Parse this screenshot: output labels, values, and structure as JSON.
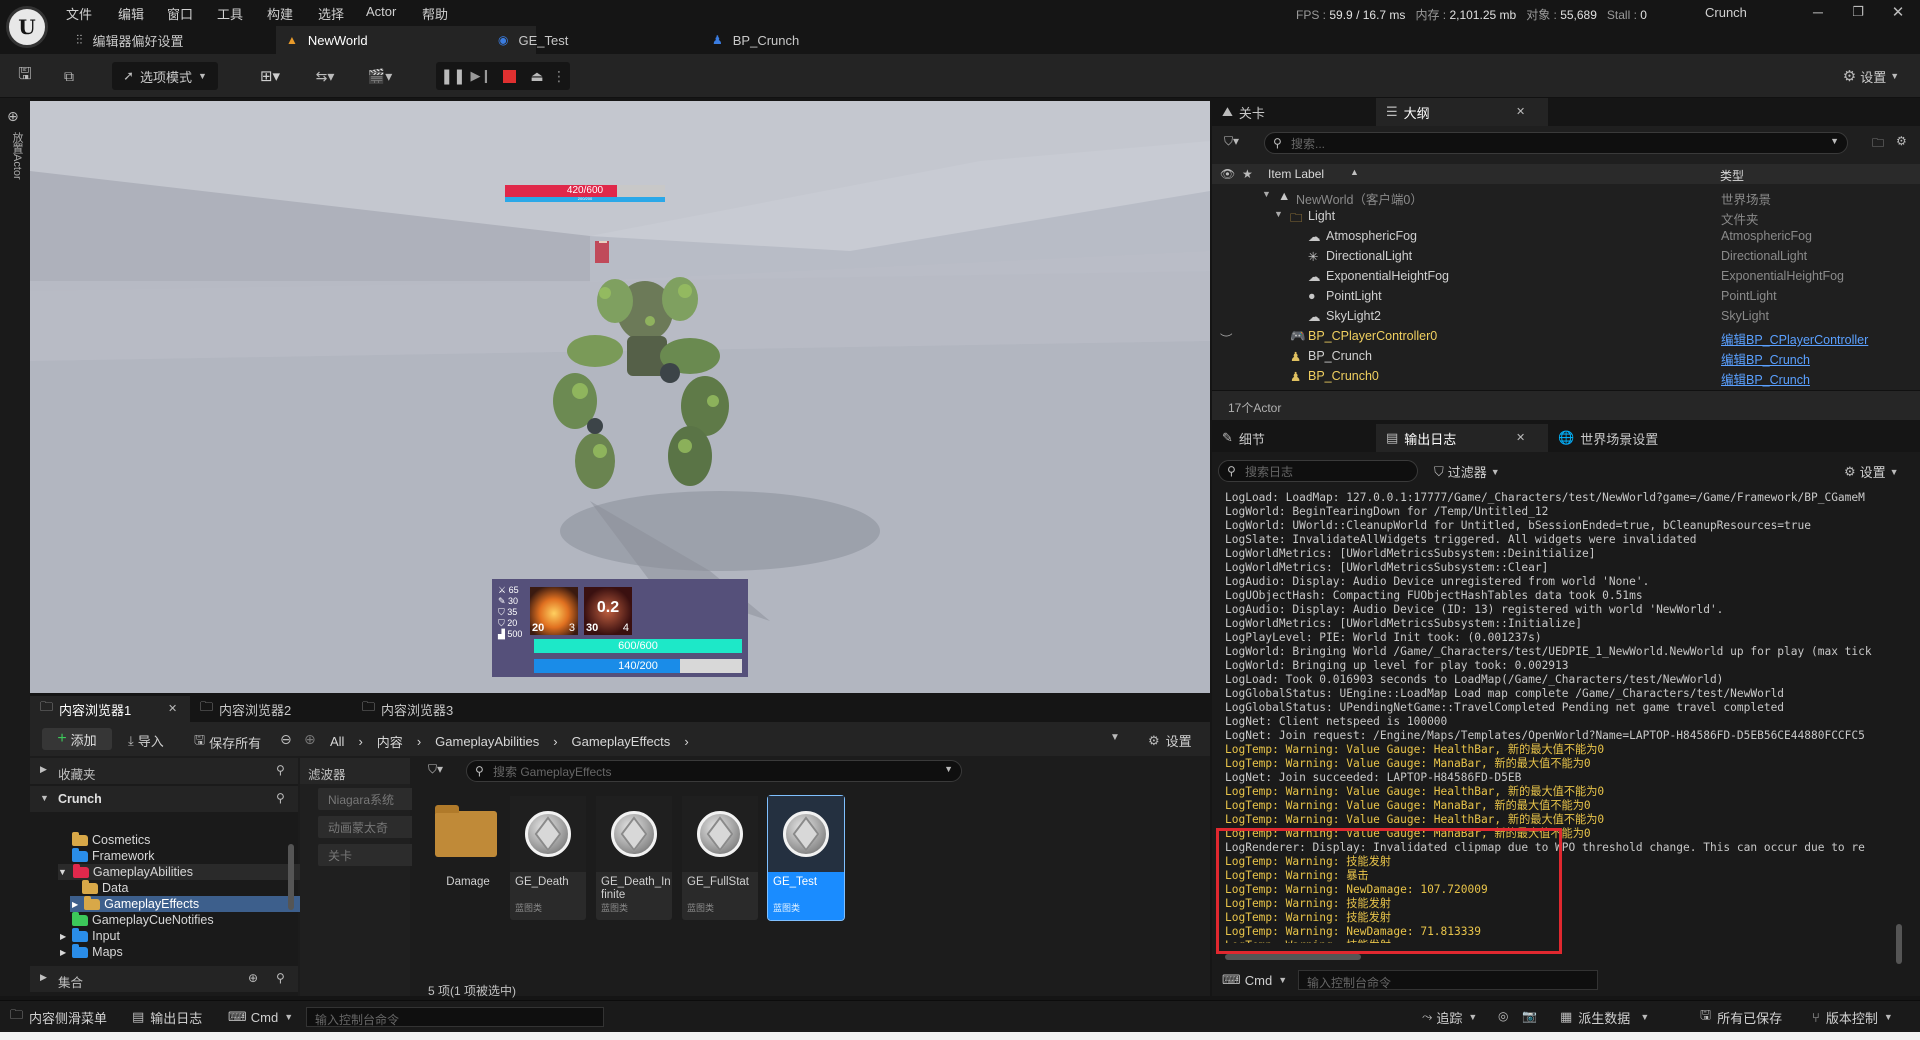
{
  "menu": [
    "文件",
    "编辑",
    "窗口",
    "工具",
    "构建",
    "选择",
    "Actor",
    "帮助"
  ],
  "stats": {
    "fps_label": "FPS :",
    "fps": "59.9",
    "ms": "/ 16.7 ms",
    "mem_label": "内存 :",
    "mem": "2,101.25 mb",
    "obj_label": "对象 :",
    "obj": "55,689",
    "stall_label": "Stall :",
    "stall": "0"
  },
  "project_name": "Crunch",
  "doc_tabs": {
    "prefs": "编辑器偏好设置",
    "newworld": "NewWorld",
    "ge_test": "GE_Test",
    "bp_crunch": "BP_Crunch"
  },
  "toolbar": {
    "mode": "选项模式",
    "settings": "设置"
  },
  "left_strip_label": "放置Actor",
  "viewport": {
    "enemy_hp": "420/600",
    "enemy_mana": "200/200",
    "stats": [
      "65",
      "30",
      "35",
      "20",
      "500"
    ],
    "skill1_level": "20",
    "skill1_cost": "3",
    "skill2_cooldown": "0.2",
    "skill2_level": "30",
    "skill2_cost": "4",
    "player_hp": "600/600",
    "player_hp_ratio": 1.0,
    "player_mana": "140/200",
    "player_mana_ratio": 0.7,
    "enemy_hp_ratio": 0.7
  },
  "outliner": {
    "tab_level": "关卡",
    "tab_outline": "大纲",
    "search_placeholder": "搜索...",
    "col_label": "Item Label",
    "col_type": "类型",
    "rows": [
      {
        "label": "NewWorld（客户端0）",
        "type": "世界场景"
      },
      {
        "label": "Light",
        "type": "文件夹"
      },
      {
        "label": "AtmosphericFog",
        "type": "AtmosphericFog"
      },
      {
        "label": "DirectionalLight",
        "type": "DirectionalLight"
      },
      {
        "label": "ExponentialHeightFog",
        "type": "ExponentialHeightFog"
      },
      {
        "label": "PointLight",
        "type": "PointLight"
      },
      {
        "label": "SkyLight2",
        "type": "SkyLight"
      },
      {
        "label": "BP_CPlayerController0",
        "type": "编辑BP_CPlayerController"
      },
      {
        "label": "BP_Crunch",
        "type": "编辑BP_Crunch"
      },
      {
        "label": "BP_Crunch0",
        "type": "编辑BP_Crunch"
      }
    ],
    "count": "17个Actor"
  },
  "log": {
    "tab_details": "细节",
    "tab_log": "输出日志",
    "tab_world": "世界场景设置",
    "search_placeholder": "搜索日志",
    "filter": "过滤器",
    "settings": "设置",
    "cmd": "Cmd",
    "cmd_placeholder": "输入控制台命令",
    "lines": [
      {
        "t": "LogLoad: LoadMap: 127.0.0.1:17777/Game/_Characters/test/NewWorld?game=/Game/Framework/BP_CGameM",
        "w": false
      },
      {
        "t": "LogWorld: BeginTearingDown for /Temp/Untitled_12",
        "w": false
      },
      {
        "t": "LogWorld: UWorld::CleanupWorld for Untitled, bSessionEnded=true, bCleanupResources=true",
        "w": false
      },
      {
        "t": "LogSlate: InvalidateAllWidgets triggered.  All widgets were invalidated",
        "w": false
      },
      {
        "t": "LogWorldMetrics: [UWorldMetricsSubsystem::Deinitialize]",
        "w": false
      },
      {
        "t": "LogWorldMetrics: [UWorldMetricsSubsystem::Clear]",
        "w": false
      },
      {
        "t": "LogAudio: Display: Audio Device unregistered from world 'None'.",
        "w": false
      },
      {
        "t": "LogUObjectHash: Compacting FUObjectHashTables data took   0.51ms",
        "w": false
      },
      {
        "t": "LogAudio: Display: Audio Device (ID: 13) registered with world 'NewWorld'.",
        "w": false
      },
      {
        "t": "LogWorldMetrics: [UWorldMetricsSubsystem::Initialize]",
        "w": false
      },
      {
        "t": "LogPlayLevel: PIE: World Init took: (0.001237s)",
        "w": false
      },
      {
        "t": "LogWorld: Bringing World /Game/_Characters/test/UEDPIE_1_NewWorld.NewWorld up for play (max tick",
        "w": false
      },
      {
        "t": "LogWorld: Bringing up level for play took: 0.002913",
        "w": false
      },
      {
        "t": "LogLoad: Took 0.016903 seconds to LoadMap(/Game/_Characters/test/NewWorld)",
        "w": false
      },
      {
        "t": "LogGlobalStatus: UEngine::LoadMap Load map complete /Game/_Characters/test/NewWorld",
        "w": false
      },
      {
        "t": "LogGlobalStatus: UPendingNetGame::TravelCompleted Pending net game travel completed",
        "w": false
      },
      {
        "t": "LogNet: Client netspeed is 100000",
        "w": false
      },
      {
        "t": "LogNet: Join request: /Engine/Maps/Templates/OpenWorld?Name=LAPTOP-H84586FD-D5EB56CE44880FCCFC5",
        "w": false
      },
      {
        "t": "LogTemp: Warning: Value Gauge: HealthBar, 新的最大值不能为0",
        "w": true
      },
      {
        "t": "LogTemp: Warning: Value Gauge: ManaBar, 新的最大值不能为0",
        "w": true
      },
      {
        "t": "LogNet: Join succeeded: LAPTOP-H84586FD-D5EB",
        "w": false
      },
      {
        "t": "LogTemp: Warning: Value Gauge: HealthBar, 新的最大值不能为0",
        "w": true
      },
      {
        "t": "LogTemp: Warning: Value Gauge: ManaBar, 新的最大值不能为0",
        "w": true
      },
      {
        "t": "LogTemp: Warning: Value Gauge: HealthBar, 新的最大值不能为0",
        "w": true
      },
      {
        "t": "LogTemp: Warning: Value Gauge: ManaBar, 新的最大值不能为0",
        "w": true
      },
      {
        "t": "LogRenderer: Display: Invalidated clipmap due to WPO threshold change. This can occur due to re",
        "w": false
      },
      {
        "t": "LogTemp: Warning: 技能发射",
        "w": true
      },
      {
        "t": "LogTemp: Warning: 暴击",
        "w": true
      },
      {
        "t": "LogTemp: Warning: NewDamage: 107.720009",
        "w": true
      },
      {
        "t": "LogTemp: Warning: 技能发射",
        "w": true
      },
      {
        "t": "LogTemp: Warning: 技能发射",
        "w": true
      },
      {
        "t": "LogTemp: Warning: NewDamage: 71.813339",
        "w": true
      },
      {
        "t": "LogTemp: Warning: 技能发射",
        "w": true
      }
    ]
  },
  "content_browser": {
    "tab1": "内容浏览器1",
    "tab2": "内容浏览器2",
    "tab3": "内容浏览器3",
    "add": "添加",
    "import": "导入",
    "save_all": "保存所有",
    "breadcrumb": [
      "All",
      "内容",
      "GameplayAbilities",
      "GameplayEffects"
    ],
    "settings": "设置",
    "favorites": "收藏夹",
    "root": "Crunch",
    "tree": [
      "Cosmetics",
      "Framework",
      "GameplayAbilities",
      "Data",
      "GameplayEffects",
      "GameplayCueNotifies",
      "Input",
      "Maps"
    ],
    "collections": "集合",
    "filters_title": "滤波器",
    "filters": [
      "Niagara系统",
      "动画蒙太奇",
      "关卡"
    ],
    "search_placeholder": "搜索 GameplayEffects",
    "assets": [
      {
        "name": "Damage",
        "sub": ""
      },
      {
        "name": "GE_Death",
        "sub": "蓝图类"
      },
      {
        "name": "GE_Death_Infinite",
        "sub": "蓝图类"
      },
      {
        "name": "GE_FullStat",
        "sub": "蓝图类"
      },
      {
        "name": "GE_Test",
        "sub": "蓝图类"
      }
    ],
    "status": "5 项(1 项被选中)"
  },
  "statusbar": {
    "drawer": "内容侧滑菜单",
    "log": "输出日志",
    "cmd": "Cmd",
    "cmd_placeholder": "输入控制台命令",
    "trace": "追踪",
    "derived": "派生数据",
    "saved": "所有已保存",
    "version": "版本控制"
  },
  "colors": {
    "accent_blue": "#1a8cff",
    "warning": "#e8c44a",
    "highlight_box": "#e0282f",
    "folder_yellow": "#d8a848",
    "folder_blue": "#2a8de8",
    "folder_red": "#e0284c",
    "folder_green": "#3cc85a"
  }
}
